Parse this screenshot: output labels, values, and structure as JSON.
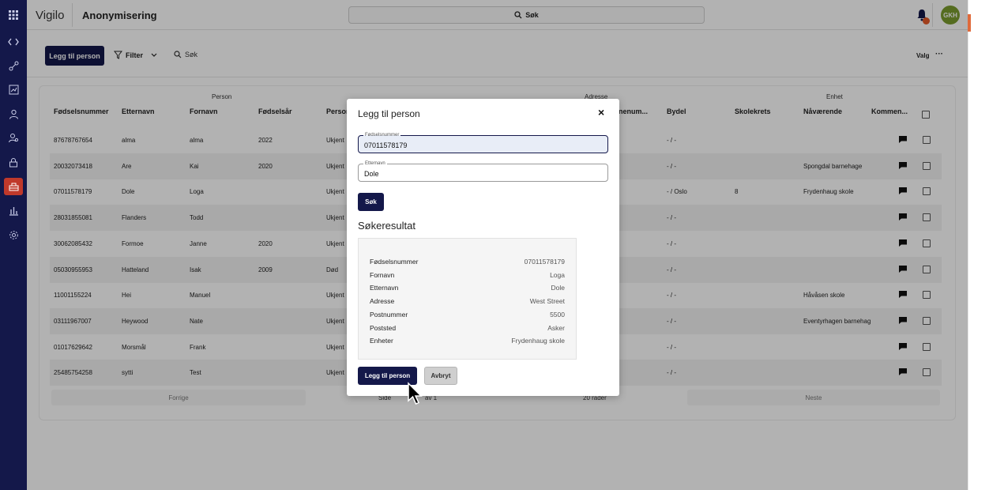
{
  "app": {
    "name": "Vigilo",
    "page_title": "Anonymisering",
    "avatar_initials": "GKH"
  },
  "search": {
    "label": "Søk"
  },
  "rail": {
    "icons": [
      "apps-icon",
      "code-icon",
      "route-icon",
      "report-icon",
      "person-icon",
      "person-search-icon",
      "lock-icon",
      "anonymize-icon",
      "bar-chart-icon",
      "gear-icon"
    ]
  },
  "toolbar": {
    "add_label": "Legg til person",
    "filter_label": "Filter",
    "search_label": "Søk",
    "valg_label": "Valg",
    "more_label": "···"
  },
  "table": {
    "groups": {
      "person": "Person",
      "address": "Adresse",
      "unit": "Enhet"
    },
    "columns": {
      "fnr": "Fødselsnummer",
      "lastname": "Etternavn",
      "firstname": "Fornavn",
      "birthyear": "Fødselsår",
      "status": "Person",
      "municipality": "...unenum...",
      "district": "Bydel",
      "schoolzone": "Skolekrets",
      "current": "Nåværende",
      "comment": "Kommen..."
    },
    "rows": [
      {
        "fnr": "87678767654",
        "lastname": "alma",
        "firstname": "alma",
        "birthyear": "2022",
        "status": "Ukjent",
        "district": "- / -",
        "schoolzone": "",
        "current": ""
      },
      {
        "fnr": "20032073418",
        "lastname": "Are",
        "firstname": "Kai",
        "birthyear": "2020",
        "status": "Ukjent",
        "district": "- / -",
        "schoolzone": "",
        "current": "Spongdal barnehage"
      },
      {
        "fnr": "07011578179",
        "lastname": "Dole",
        "firstname": "Loga",
        "birthyear": "",
        "status": "Ukjent",
        "district": "- / Oslo",
        "schoolzone": "8",
        "current": "Frydenhaug skole"
      },
      {
        "fnr": "28031855081",
        "lastname": "Flanders",
        "firstname": "Todd",
        "birthyear": "",
        "status": "Ukjent",
        "district": "- / -",
        "schoolzone": "",
        "current": ""
      },
      {
        "fnr": "30062085432",
        "lastname": "Formoe",
        "firstname": "Janne",
        "birthyear": "2020",
        "status": "Ukjent",
        "district": "- / -",
        "schoolzone": "",
        "current": ""
      },
      {
        "fnr": "05030955953",
        "lastname": "Hatteland",
        "firstname": "Isak",
        "birthyear": "2009",
        "status": "Død",
        "district": "- / -",
        "schoolzone": "",
        "current": ""
      },
      {
        "fnr": "11001155224",
        "lastname": "Hei",
        "firstname": "Manuel",
        "birthyear": "",
        "status": "Ukjent",
        "district": "- / -",
        "schoolzone": "",
        "current": "Håvåsen skole"
      },
      {
        "fnr": "03111967007",
        "lastname": "Heywood",
        "firstname": "Nate",
        "birthyear": "",
        "status": "Ukjent",
        "district": "- / -",
        "schoolzone": "",
        "current": "Eventyrhagen barnehag"
      },
      {
        "fnr": "01017629642",
        "lastname": "Morsmål",
        "firstname": "Frank",
        "birthyear": "",
        "status": "Ukjent",
        "district": "- / -",
        "schoolzone": "",
        "current": ""
      },
      {
        "fnr": "25485754258",
        "lastname": "sytti",
        "firstname": "Test",
        "birthyear": "",
        "status": "Ukjent",
        "district": "- / -",
        "schoolzone": "",
        "current": ""
      }
    ],
    "pager": {
      "prev": "Forrige",
      "page_label": "Side",
      "of_label": "av 1",
      "rows_label": "20 rader",
      "next": "Neste"
    }
  },
  "modal": {
    "title": "Legg til person",
    "close_label": "×",
    "fnr_label": "Fødselsnummer",
    "fnr_value": "07011578179",
    "lastname_label": "Etternavn",
    "lastname_value": "Dole",
    "search_button": "Søk",
    "results_title": "Søkeresultat",
    "result": [
      {
        "key": "Fødselsnummer",
        "value": "07011578179"
      },
      {
        "key": "Fornavn",
        "value": "Loga"
      },
      {
        "key": "Etternavn",
        "value": "Dole"
      },
      {
        "key": "Adresse",
        "value": "West Street"
      },
      {
        "key": "Postnummer",
        "value": "5500"
      },
      {
        "key": "Poststed",
        "value": "Asker"
      },
      {
        "key": "Enheter",
        "value": "Frydenhaug skole"
      }
    ],
    "add_button": "Legg til person",
    "cancel_button": "Avbryt"
  },
  "colors": {
    "navy": "#14184a",
    "accent": "#c0392b",
    "avatar": "#7a9b2e",
    "badge": "#e55b2a"
  }
}
